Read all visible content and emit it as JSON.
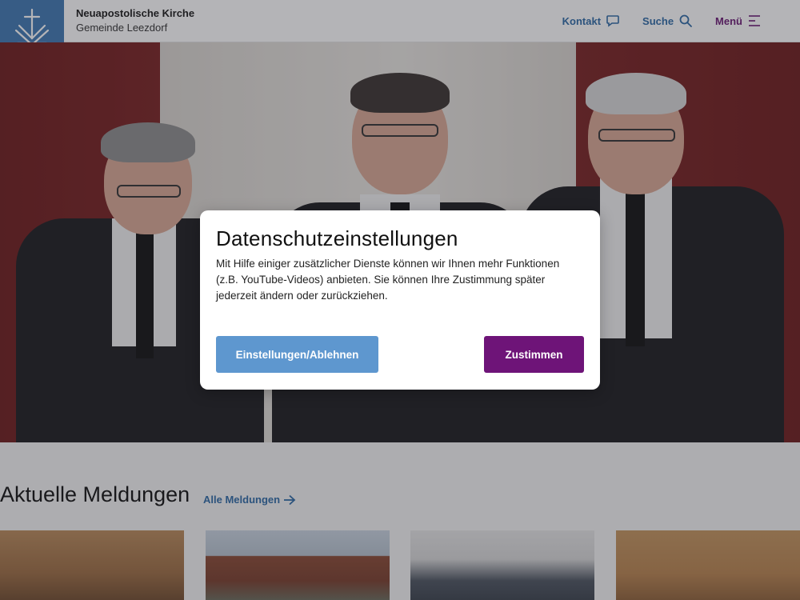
{
  "header": {
    "brand_name": "Neuapostolische Kirche",
    "brand_sub": "Gemeinde Leezdorf",
    "nav": {
      "contact": "Kontakt",
      "search": "Suche",
      "menu": "Menü"
    }
  },
  "news": {
    "title": "Aktuelle Meldungen",
    "all_link": "Alle Meldungen"
  },
  "modal": {
    "title": "Datenschutzeinstellungen",
    "text": "Mit Hilfe einiger zusätzlicher Dienste können wir Ihnen mehr Funktionen (z.B. YouTube-Videos) anbieten. Sie können Ihre Zustimmung später jederzeit ändern oder zurückziehen.",
    "settings_button": "Einstellungen/Ablehnen",
    "accept_button": "Zustimmen"
  },
  "icons": {
    "logo": "church-logo-icon",
    "contact": "speech-bubble-icon",
    "search": "search-icon",
    "menu": "hamburger-menu-icon",
    "arrow": "arrow-right-icon"
  },
  "colors": {
    "logo_bg": "#3f79b3",
    "link_blue": "#2e6aa6",
    "menu_purple": "#6a1a73",
    "settings_button": "#5e97cf",
    "accept_button": "#6e1478"
  }
}
